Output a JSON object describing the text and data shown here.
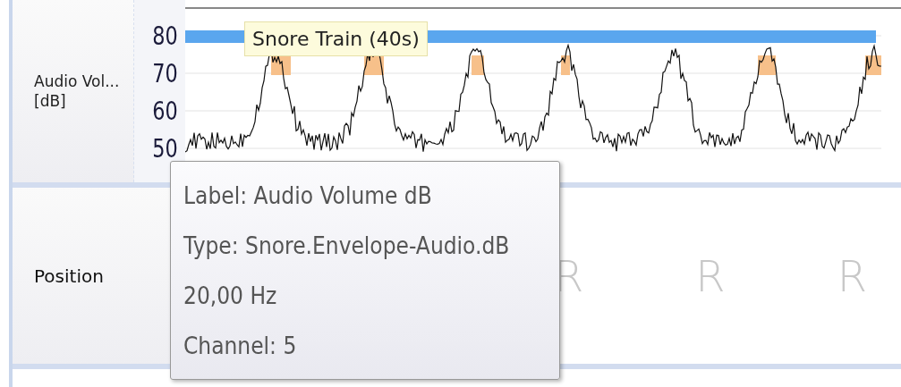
{
  "tracks": [
    {
      "kind": "signal",
      "label": "Audio Vol...",
      "unit": "[dB]",
      "yticks": [
        "80",
        "70",
        "60",
        "50"
      ],
      "event": {
        "label": "Snore Train (40s)"
      }
    },
    {
      "kind": "markers",
      "label": "Position",
      "markers": [
        "R",
        "R",
        "R"
      ]
    }
  ],
  "tooltip": {
    "lines": [
      "Label: Audio Volume dB",
      "Type: Snore.Envelope-Audio.dB",
      "20,00 Hz",
      "Channel: 5"
    ]
  }
}
